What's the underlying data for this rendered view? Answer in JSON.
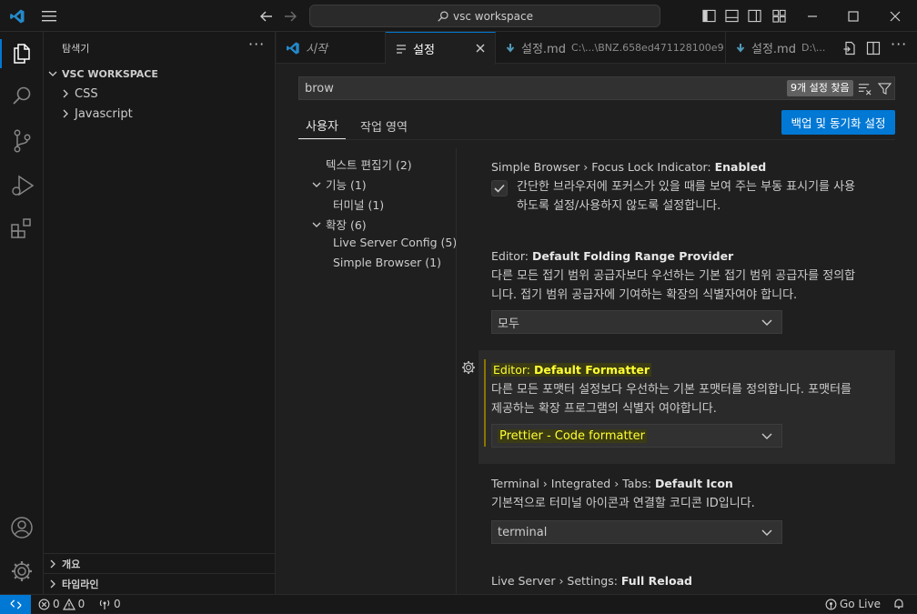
{
  "titlebar": {
    "search_text": "vsc workspace",
    "window_min": "minimize",
    "window_max": "maximize",
    "window_close": "close"
  },
  "sidebar": {
    "title": "탐색기",
    "workspace": "VSC WORKSPACE",
    "folders": [
      "CSS",
      "Javascript"
    ],
    "outline": "개요",
    "timeline": "타임라인"
  },
  "tabs": [
    {
      "label": "시작",
      "path": ""
    },
    {
      "label": "설정",
      "path": ""
    },
    {
      "label": "설정.md",
      "path": "C:\\...\\BNZ.658ed471128100e9"
    },
    {
      "label": "설정.md",
      "path": "D:\\..."
    }
  ],
  "settings": {
    "search_value": "brow",
    "found_badge": "9개 설정 찾음",
    "scope_tabs": [
      "사용자",
      "작업 영역"
    ],
    "sync_button": "백업 및 동기화 설정",
    "toc": [
      {
        "label": "텍스트 편집기 (2)"
      },
      {
        "label": "기능 (1)"
      },
      {
        "label": "터미널 (1)"
      },
      {
        "label": "확장 (6)"
      },
      {
        "label": "Live Server Config (5)"
      },
      {
        "label": "Simple Browser (1)"
      }
    ],
    "items": [
      {
        "category": "Simple Browser › Focus Lock Indicator: ",
        "name": "Enabled",
        "desc1": "간단한 브라우저에 포커스가 있을 때를 보여 주는 부동 표시기를 사용",
        "desc2": "하도록 설정/사용하지 않도록 설정합니다."
      },
      {
        "category": "Editor: ",
        "name": "Default Folding Range Provider",
        "desc1": "다른 모든 접기 범위 공급자보다 우선하는 기본 접기 범위 공급자를 정의합",
        "desc2": "니다. 접기 범위 공급자에 기여하는 확장의 식별자여야 합니다.",
        "value": "모두"
      },
      {
        "category": "Editor: ",
        "name": "Default Formatter",
        "desc1": "다른 모든 포맷터 설정보다 우선하는 기본 포맷터를 정의합니다. 포맷터를",
        "desc2": "제공하는 확장 프로그램의 식별자 여야합니다.",
        "value": "Prettier - Code formatter"
      },
      {
        "category": "Terminal › Integrated › Tabs: ",
        "name": "Default Icon",
        "desc1": "기본적으로 터미널 아이콘과 연결할 코디콘 ID입니다.",
        "value": "terminal"
      },
      {
        "category": "Live Server › Settings: ",
        "name": "Full Reload"
      }
    ]
  },
  "statusbar": {
    "errors": "0",
    "warnings": "0",
    "ports": "0",
    "golive": "Go Live"
  },
  "colors": {
    "accent": "#0078d4",
    "button": "#0078d4",
    "highlight": "#ffff00"
  }
}
